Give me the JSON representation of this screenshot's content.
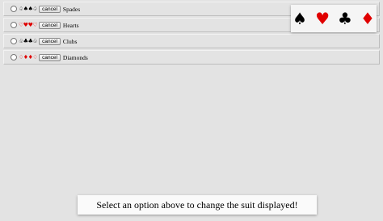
{
  "rows": [
    {
      "glyphs": [
        {
          "char": "♤",
          "color": "#000000"
        },
        {
          "char": "♠",
          "color": "#000000"
        },
        {
          "char": "♠",
          "color": "#000000"
        },
        {
          "char": "♤",
          "color": "#000000"
        }
      ],
      "cancel_label": "cancel",
      "suit": "Spades"
    },
    {
      "glyphs": [
        {
          "char": "♡",
          "color": "#e00000"
        },
        {
          "char": "♥",
          "color": "#e00000"
        },
        {
          "char": "♥",
          "color": "#e00000"
        },
        {
          "char": "♡",
          "color": "#e00000"
        }
      ],
      "cancel_label": "cancel",
      "suit": "Hearts"
    },
    {
      "glyphs": [
        {
          "char": "♧",
          "color": "#000000"
        },
        {
          "char": "♣",
          "color": "#000000"
        },
        {
          "char": "♣",
          "color": "#000000"
        },
        {
          "char": "♧",
          "color": "#000000"
        }
      ],
      "cancel_label": "cancel",
      "suit": "Clubs"
    },
    {
      "glyphs": [
        {
          "char": "♢",
          "color": "#e00000"
        },
        {
          "char": "♦",
          "color": "#e00000"
        },
        {
          "char": "♦",
          "color": "#e00000"
        },
        {
          "char": "♢",
          "color": "#e00000"
        }
      ],
      "cancel_label": "cancel",
      "suit": "Diamonds"
    }
  ],
  "suit_display": [
    {
      "name": "spade-icon",
      "char": "♠",
      "color": "#000000"
    },
    {
      "name": "heart-icon",
      "char": "♥",
      "color": "#e00000"
    },
    {
      "name": "club-icon",
      "char": "♣",
      "color": "#000000"
    },
    {
      "name": "diamond-icon",
      "char": "♦",
      "color": "#e00000"
    }
  ],
  "message": "Select an option above to change the suit displayed!"
}
